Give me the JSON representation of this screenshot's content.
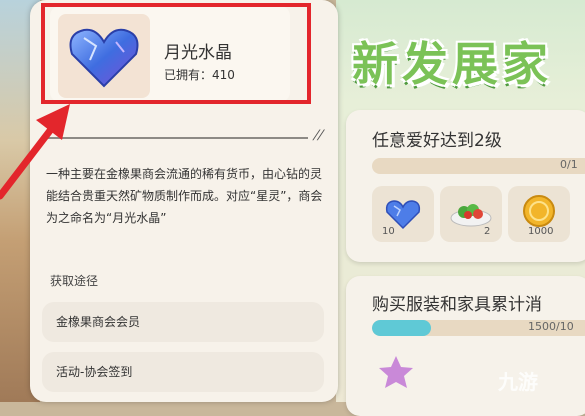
{
  "item": {
    "name": "月光水晶",
    "count_label": "已拥有：",
    "count_value": "410",
    "icon": "blue-crystal-heart-icon",
    "description": "一种主要在金橡果商会流通的稀有货币，由心钻的灵能结合贵重天然矿物质制作而成。对应“星灵”，商会为之命名为“月光水晶”",
    "source_heading": "获取途径",
    "sources": [
      "金橡果商会会员",
      "活动-协会签到"
    ]
  },
  "right_panel": {
    "banner_title": "新发展家",
    "tasks": [
      {
        "title": "任意爱好达到2级",
        "progress_text": "0/1",
        "progress": 0,
        "rewards": [
          {
            "icon": "blue-crystal-heart-icon",
            "qty": "10"
          },
          {
            "icon": "salad-dish-icon",
            "qty": "2"
          },
          {
            "icon": "gold-coin-icon",
            "qty": "1000"
          }
        ]
      },
      {
        "title": "购买服装和家具累计消",
        "progress_text": "1500/10",
        "progress": 0.27
      }
    ]
  },
  "watermark": "九游",
  "colors": {
    "highlight": "#e3262c",
    "banner_green": "#7bc257",
    "progress_fill": "#5fc9d6"
  }
}
